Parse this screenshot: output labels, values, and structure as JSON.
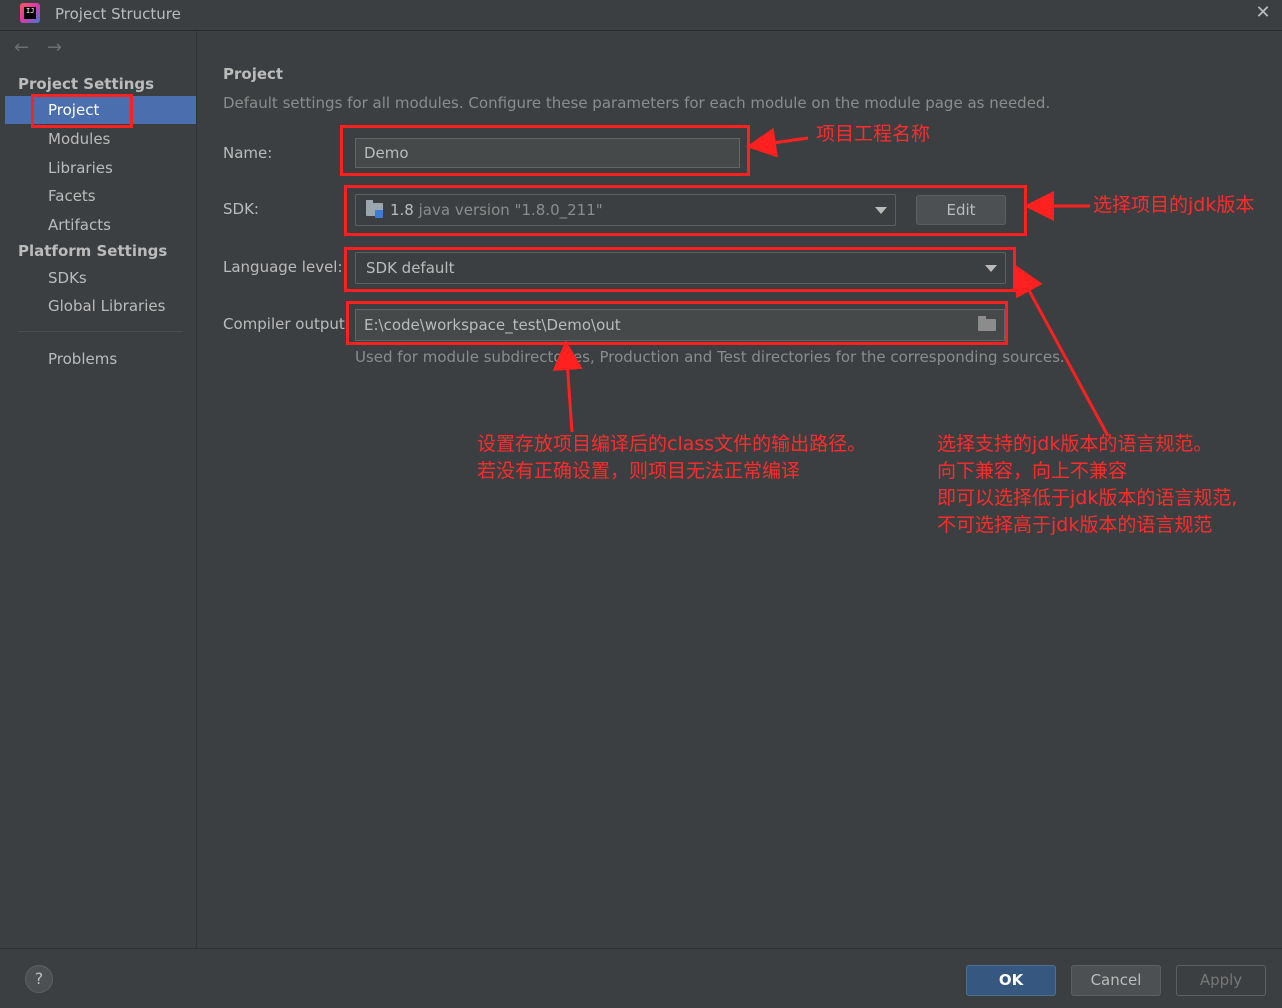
{
  "window": {
    "title": "Project Structure",
    "close": "✕"
  },
  "nav": {
    "back": "←",
    "forward": "→"
  },
  "sidebar": {
    "project_settings_header": "Project Settings",
    "project_settings_items": [
      "Project",
      "Modules",
      "Libraries",
      "Facets",
      "Artifacts"
    ],
    "platform_settings_header": "Platform Settings",
    "platform_settings_items": [
      "SDKs",
      "Global Libraries"
    ],
    "other_items": [
      "Problems"
    ],
    "selected": "Project"
  },
  "main": {
    "title": "Project",
    "description": "Default settings for all modules. Configure these parameters for each module on the module page as needed.",
    "name_label": "Name:",
    "name_value": "Demo",
    "sdk_label": "SDK:",
    "sdk_version": "1.8",
    "sdk_detail": "java version \"1.8.0_211\"",
    "sdk_edit_button": "Edit",
    "language_level_label": "Language level:",
    "language_level_value": "SDK default",
    "compiler_output_label": "Compiler output:",
    "compiler_output_value": "E:\\code\\workspace_test\\Demo\\out",
    "compiler_output_hint": "Used for module subdirectories, Production and Test directories for the corresponding sources."
  },
  "footer": {
    "help": "?",
    "ok": "OK",
    "cancel": "Cancel",
    "apply": "Apply"
  },
  "annotations": {
    "name_note": "项目工程名称",
    "sdk_note": "选择项目的jdk版本",
    "output_note": "设置存放项目编译后的class文件的输出路径。\n若没有正确设置，则项目无法正常编译",
    "language_note": "选择支持的jdk版本的语言规范。\n向下兼容，向上不兼容\n即可以选择低于jdk版本的语言规范,\n不可选择高于jdk版本的语言规范"
  },
  "colors": {
    "background": "#3c3f41",
    "selection": "#4b6eaf",
    "primary_button": "#365880",
    "annotation_red": "#ff2020"
  }
}
